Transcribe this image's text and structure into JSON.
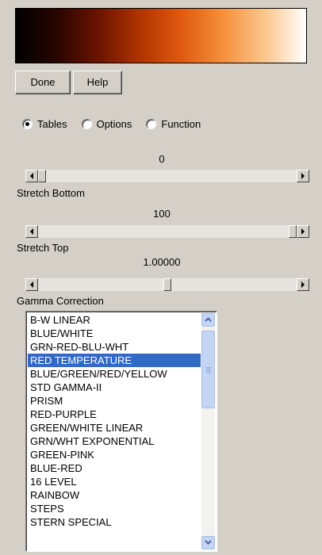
{
  "colorbar": {
    "stops": [
      "#000000",
      "#2a0500",
      "#6b1400",
      "#b03400",
      "#e05a10",
      "#f5903c",
      "#fbc68c",
      "#ffffff"
    ]
  },
  "buttons": {
    "done": "Done",
    "help": "Help"
  },
  "modes": {
    "selected": "Tables",
    "options": [
      "Tables",
      "Options",
      "Function"
    ]
  },
  "sliders": {
    "stretch_bottom": {
      "value": "0",
      "label": "Stretch Bottom",
      "position": 0.0
    },
    "stretch_top": {
      "value": "100",
      "label": "Stretch Top",
      "position": 1.0
    },
    "gamma": {
      "value": "1.00000",
      "label": "Gamma Correction",
      "position": 0.5
    }
  },
  "color_tables": {
    "selected": "RED TEMPERATURE",
    "items": [
      "B-W LINEAR",
      "BLUE/WHITE",
      "GRN-RED-BLU-WHT",
      "RED TEMPERATURE",
      "BLUE/GREEN/RED/YELLOW",
      "STD GAMMA-II",
      "PRISM",
      "RED-PURPLE",
      "GREEN/WHITE LINEAR",
      "GRN/WHT EXPONENTIAL",
      "GREEN-PINK",
      "BLUE-RED",
      "16 LEVEL",
      "RAINBOW",
      "STEPS",
      "STERN SPECIAL"
    ]
  }
}
